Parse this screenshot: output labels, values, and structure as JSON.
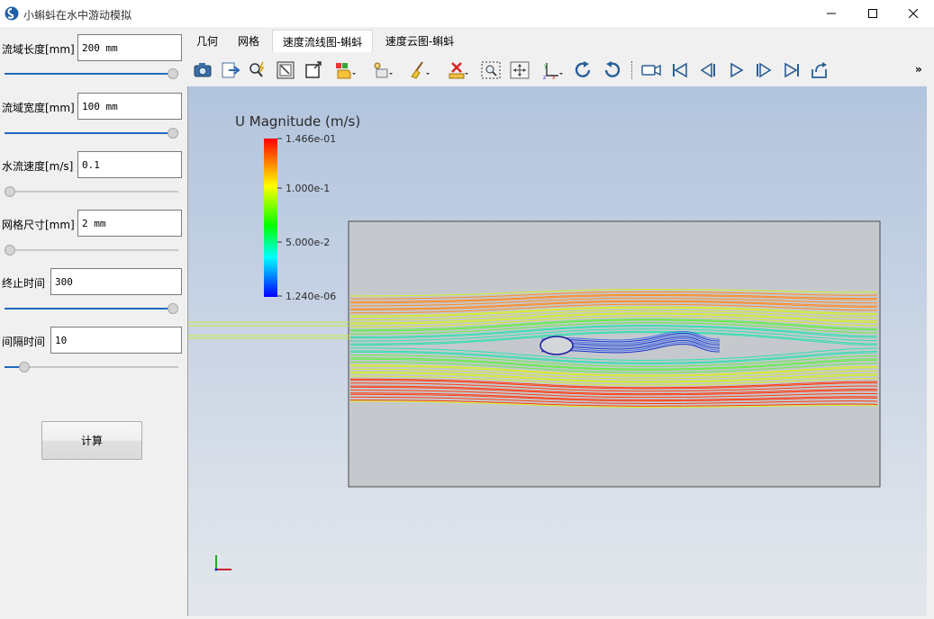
{
  "window": {
    "title": "小蝌蚪在水中游动模拟",
    "minimize_icon": "minimize-icon",
    "maximize_icon": "maximize-icon",
    "close_icon": "close-icon"
  },
  "params": [
    {
      "label": "流域长度[mm]",
      "value": "200 mm",
      "slider": 1.0
    },
    {
      "label": "流域宽度[mm]",
      "value": "100 mm",
      "slider": 1.0
    },
    {
      "label": "水流速度[m/s]",
      "value": "0.1",
      "slider": 0.0
    },
    {
      "label": "网格尺寸[mm]",
      "value": "2 mm",
      "slider": 0.0
    },
    {
      "label": "终止时间",
      "value": "300",
      "slider": 1.0
    },
    {
      "label": "间隔时间",
      "value": "10",
      "slider": 0.09
    }
  ],
  "calc_button": "计算",
  "tabs": [
    {
      "label": "几何",
      "active": false
    },
    {
      "label": "网格",
      "active": false
    },
    {
      "label": "速度流线图-蝌蚪",
      "active": true
    },
    {
      "label": "速度云图-蝌蚪",
      "active": false
    }
  ],
  "toolbar": {
    "icons": [
      "camera-icon",
      "export-icon",
      "zoom-interactive-icon",
      "reset-camera-icon",
      "zoom-to-data-icon",
      "color-map-icon",
      "select-icon",
      "clean-icon",
      "delete-icon",
      "zoom-box-icon",
      "pick-center-icon",
      "axes-icon",
      "rotate-cw-icon",
      "rotate-ccw-icon",
      "record-icon",
      "first-frame-icon",
      "previous-frame-icon",
      "play-icon",
      "next-frame-icon",
      "last-frame-icon",
      "loop-icon"
    ],
    "more": "»"
  },
  "legend": {
    "title": "U Magnitude (m/s)",
    "ticks": [
      "1.466e-01",
      "1.000e-1",
      "5.000e-2",
      "1.240e-06"
    ],
    "colors": [
      "#ff0000",
      "#ffff00",
      "#00ff00",
      "#00ffff",
      "#0000ff"
    ]
  },
  "accent_color": "#1e6bbf"
}
